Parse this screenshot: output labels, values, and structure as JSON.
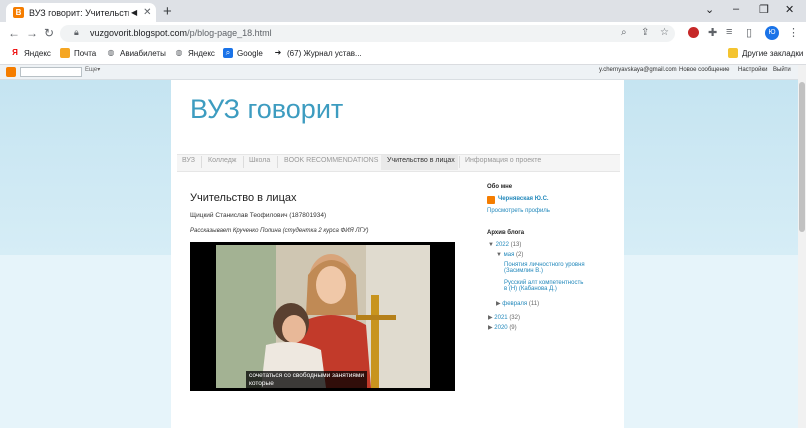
{
  "browser": {
    "tab_title": "ВУЗ говорит: Учительство в",
    "tab_favicon": "B",
    "url_host": "vuzgovorit.blogspot.com",
    "url_path": "/p/blog-page_18.html",
    "profile_initials": "Ю"
  },
  "bookmarks": {
    "items": [
      {
        "label": "Яндекс",
        "icon": "yandex-icon"
      },
      {
        "label": "Почта",
        "icon": "mail-icon"
      },
      {
        "label": "Авиабилеты",
        "icon": "globe-icon"
      },
      {
        "label": "Яндекс",
        "icon": "globe-icon"
      },
      {
        "label": "Google",
        "icon": "search-icon"
      },
      {
        "label": "(67) Журнал устав...",
        "icon": "arrow-icon"
      }
    ],
    "other": "Другие закладки"
  },
  "blogger_nav": {
    "search_button": "Еще▾",
    "email": "y.chernyavskaya@gmail.com",
    "links": [
      "Новое сообщение",
      "Настройки",
      "Выйти"
    ]
  },
  "blog": {
    "title": "ВУЗ говорит",
    "tabs": [
      "ВУЗ",
      "Колледж",
      "Школа",
      "BOOK RECOMMENDATIONS",
      "Учительство в лицах",
      "Информация о проекте"
    ],
    "active_tab": "Учительство в лицах"
  },
  "post": {
    "title": "Учительство в лицах",
    "line1": "Щицкий Станислав Теофилович (187801934)",
    "line2": "Рассказывает Крученко Полина (студентка 2 курса ФИЯ ЛГУ)",
    "caption_line1": "сочетаться со свободными занятиями",
    "caption_line2": "которые"
  },
  "sidebar": {
    "about_heading": "Обо мне",
    "author": "Чернявская Ю.С.",
    "profile_link": "Просмотреть профиль",
    "archive_heading": "Архив блога",
    "archive": {
      "y2022": "2022",
      "y2022_count": "(13)",
      "may": "мая",
      "may_count": "(2)",
      "post1": "Понятия личностного уровня (Засимлин В.)",
      "post2": "Русский алт компетентность в (Н) (Кабанова Д.)",
      "feb": "февраля",
      "feb_count": "(11)",
      "y2021": "2021",
      "y2021_count": "(32)",
      "y2020": "2020",
      "y2020_count": "(9)"
    }
  }
}
